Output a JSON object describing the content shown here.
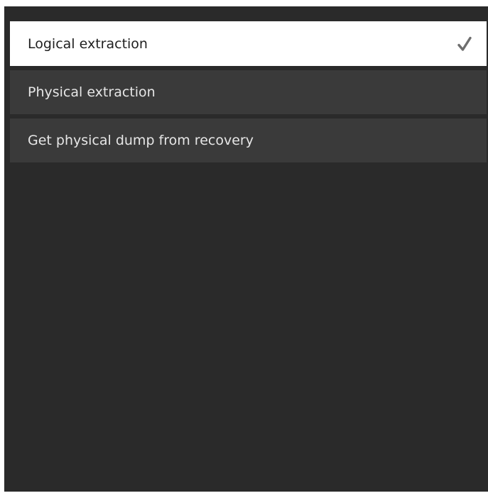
{
  "menu": {
    "options": [
      {
        "label": "Logical extraction",
        "selected": true
      },
      {
        "label": "Physical extraction",
        "selected": false
      },
      {
        "label": "Get physical dump from recovery",
        "selected": false
      }
    ]
  },
  "icons": {
    "selected_indicator": "checkmark-icon"
  },
  "colors": {
    "panel_background": "#2a2a2a",
    "option_background": "#3a3a3a",
    "selected_background": "#ffffff",
    "selected_text": "#1f1f1f",
    "option_text": "#e6e6e6",
    "checkmark": "#6e6e6e"
  }
}
